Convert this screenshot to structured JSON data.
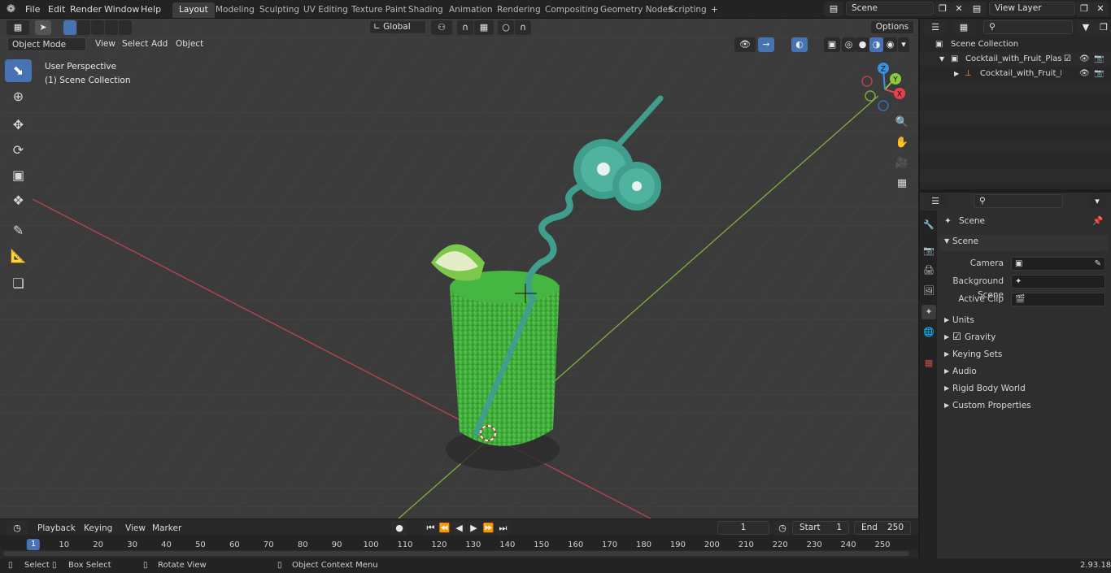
{
  "menu": {
    "file": "File",
    "edit": "Edit",
    "render": "Render",
    "window": "Window",
    "help": "Help"
  },
  "workspaces": [
    "Layout",
    "Modeling",
    "Sculpting",
    "UV Editing",
    "Texture Paint",
    "Shading",
    "Animation",
    "Rendering",
    "Compositing",
    "Geometry Nodes",
    "Scripting"
  ],
  "workspace_add": "+",
  "scene_name": "Scene",
  "view_layer": "View Layer",
  "viewport": {
    "mode": "Object Mode",
    "menus": {
      "view": "View",
      "select": "Select",
      "add": "Add",
      "object": "Object"
    },
    "transform_orientation": "Global",
    "options_label": "Options",
    "overlay_line1": "User Perspective",
    "overlay_line2": "(1) Scene Collection",
    "gizmo_axes": {
      "x": "X",
      "y": "Y",
      "z": "Z"
    }
  },
  "outliner": {
    "root": "Scene Collection",
    "rows": [
      "Cocktail_with_Fruit_Plastic_St",
      "Cocktail_with_Fruit_Plast"
    ]
  },
  "properties": {
    "header": "Scene",
    "panel_title": "Scene",
    "camera_label": "Camera",
    "background_scene_label": "Background Scene",
    "active_clip_label": "Active Clip",
    "sections": {
      "units": "Units",
      "gravity": "Gravity",
      "keying_sets": "Keying Sets",
      "audio": "Audio",
      "rigid_body_world": "Rigid Body World",
      "custom_properties": "Custom Properties"
    }
  },
  "timeline": {
    "menus": {
      "playback": "Playback",
      "keying": "Keying",
      "view": "View",
      "marker": "Marker"
    },
    "current_frame": "1",
    "start_label": "Start",
    "start_value": "1",
    "end_label": "End",
    "end_value": "250",
    "ruler": [
      "1",
      "10",
      "20",
      "30",
      "40",
      "50",
      "60",
      "70",
      "80",
      "90",
      "100",
      "110",
      "120",
      "130",
      "140",
      "150",
      "160",
      "170",
      "180",
      "190",
      "200",
      "210",
      "220",
      "230",
      "240",
      "250"
    ]
  },
  "statusbar": {
    "select": "Select",
    "box_select": "Box Select",
    "rotate_view": "Rotate View",
    "context_menu": "Object Context Menu",
    "version": "2.93.18"
  },
  "colors": {
    "accent": "#4772b3",
    "x_axis": "#e5424e",
    "y_axis": "#8acb3a",
    "z_axis": "#3d8fe0",
    "liquid": "#3bb33a",
    "straw": "#3f9e8c"
  }
}
